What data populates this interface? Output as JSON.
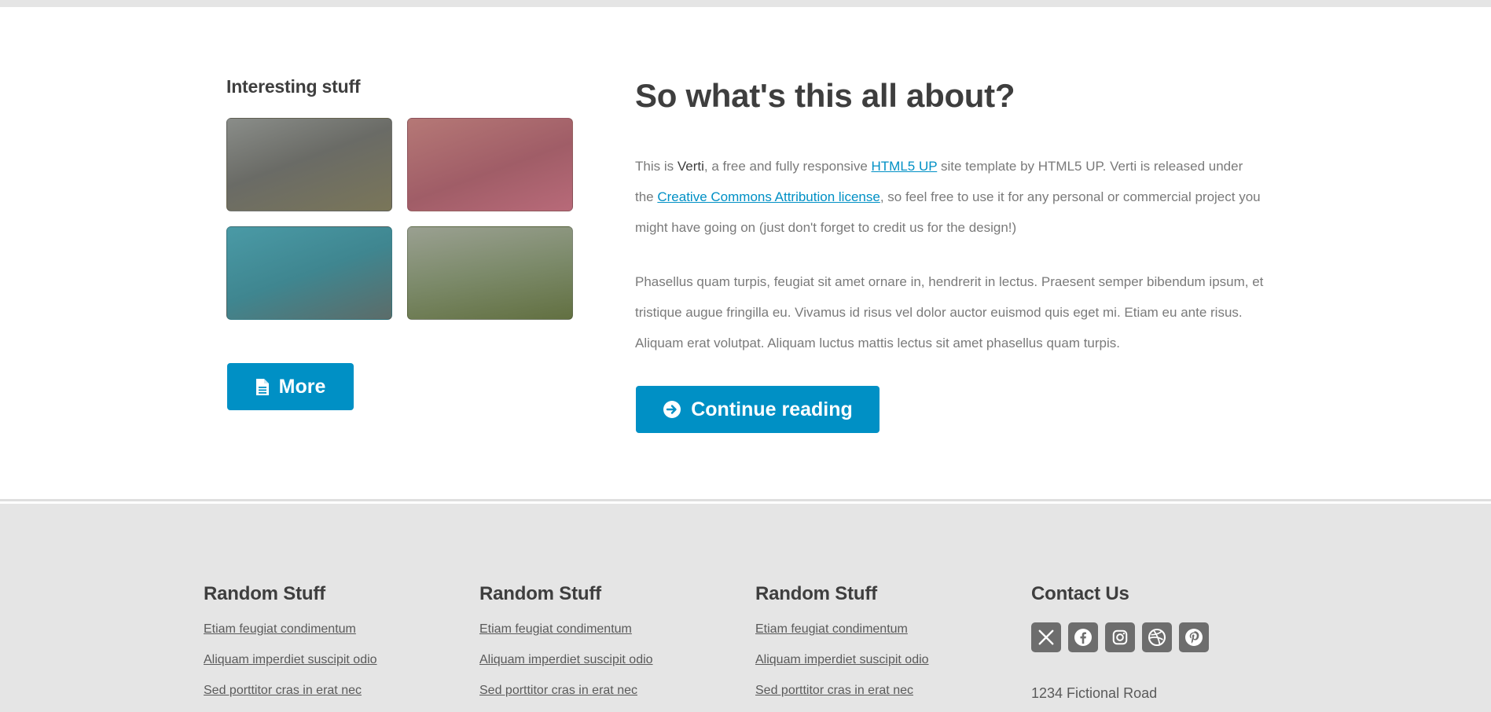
{
  "sidebar": {
    "title": "Interesting stuff",
    "more_label": "More"
  },
  "article": {
    "headline": "So what's this all about?",
    "p1_a": "This is ",
    "p1_strong": "Verti",
    "p1_b": ", a free and fully responsive ",
    "p1_link1": "HTML5 UP",
    "p1_c": " site template by HTML5 UP. Verti is released under the ",
    "p1_link2": "Creative Commons Attribution license",
    "p1_d": ", so feel free to use it for any personal or commercial project you might have going on (just don't forget to credit us for the design!)",
    "p2": "Phasellus quam turpis, feugiat sit amet ornare in, hendrerit in lectus. Praesent semper bibendum ipsum, et tristique augue fringilla eu. Vivamus id risus vel dolor auctor euismod quis eget mi. Etiam eu ante risus. Aliquam erat volutpat. Aliquam luctus mattis lectus sit amet phasellus quam turpis.",
    "continue_label": "Continue reading"
  },
  "footer": {
    "columns": [
      {
        "title": "Random Stuff",
        "links": [
          "Etiam feugiat condimentum",
          "Aliquam imperdiet suscipit odio",
          "Sed porttitor cras in erat nec"
        ]
      },
      {
        "title": "Random Stuff",
        "links": [
          "Etiam feugiat condimentum",
          "Aliquam imperdiet suscipit odio",
          "Sed porttitor cras in erat nec"
        ]
      },
      {
        "title": "Random Stuff",
        "links": [
          "Etiam feugiat condimentum",
          "Aliquam imperdiet suscipit odio",
          "Sed porttitor cras in erat nec"
        ]
      }
    ],
    "contact": {
      "title": "Contact Us",
      "socials": [
        "x-icon",
        "facebook-icon",
        "instagram-icon",
        "dribbble-icon",
        "pinterest-icon"
      ],
      "address": "1234 Fictional Road"
    }
  },
  "colors": {
    "accent": "#0090c5",
    "heading": "#3e3e3e",
    "footer_bg": "#e5e5e5"
  }
}
